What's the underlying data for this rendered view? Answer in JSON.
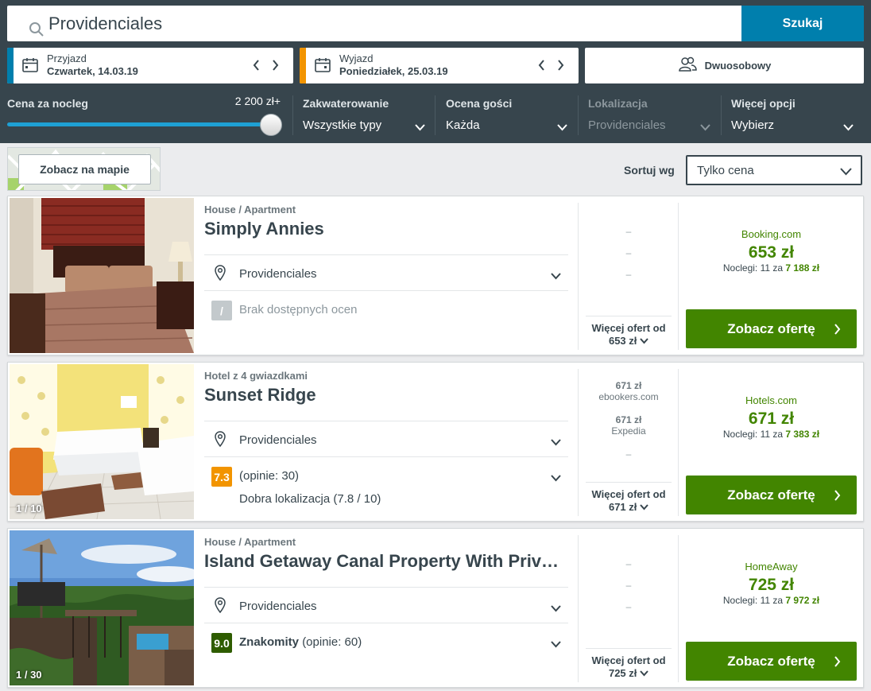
{
  "search": {
    "value": "Providenciales",
    "button": "Szukaj"
  },
  "checkin": {
    "label": "Przyjazd",
    "value": "Czwartek, 14.03.19",
    "accent": "#007fad"
  },
  "checkout": {
    "label": "Wyjazd",
    "value": "Poniedziałek, 25.03.19",
    "accent": "#f29400"
  },
  "room": {
    "label": "Dwuosobowy"
  },
  "filters": {
    "price": {
      "label": "Cena za nocleg",
      "max": "2 200 zł+",
      "level_percent": 100
    },
    "accommodation": {
      "label": "Zakwaterowanie",
      "value": "Wszystkie typy"
    },
    "rating": {
      "label": "Ocena gości",
      "value": "Każda"
    },
    "location": {
      "label": "Lokalizacja",
      "value": "Providenciales"
    },
    "more": {
      "label": "Więcej opcji",
      "value": "Wybierz"
    }
  },
  "toolbar": {
    "map_button": "Zobacz na mapie",
    "sort_label": "Sortuj wg",
    "sort_value": "Tylko cena"
  },
  "results": [
    {
      "category": "House / Apartment",
      "name": "Simply Annies",
      "location": "Providenciales",
      "rating_badge": "/",
      "rating_text": "Brak dostępnych ocen",
      "offers": [],
      "more_offers_label": "Więcej ofert od",
      "more_offers_price": "653 zł",
      "best_site": "Booking.com",
      "best_price": "653 zł",
      "nights_prefix": "Noclegi: 11 za",
      "nights_total": "7 188 zł",
      "cta": "Zobacz ofertę"
    },
    {
      "category": "Hotel z 4 gwiazdkami",
      "name": "Sunset Ridge",
      "photo_counter": "1 / 10",
      "location": "Providenciales",
      "rating_badge": "7.3",
      "rating_text": "(opinie: 30)",
      "rating_sub": "Dobra lokalizacja (7.8 / 10)",
      "offers": [
        {
          "price": "671 zł",
          "site": "ebookers.com"
        },
        {
          "price": "671 zł",
          "site": "Expedia"
        }
      ],
      "more_offers_label": "Więcej ofert od",
      "more_offers_price": "671 zł",
      "best_site": "Hotels.com",
      "best_price": "671 zł",
      "nights_prefix": "Noclegi: 11 za",
      "nights_total": "7 383 zł",
      "cta": "Zobacz ofertę"
    },
    {
      "category": "House / Apartment",
      "name": "Island Getaway Canal Property With Priv…",
      "photo_counter": "1 / 30",
      "location": "Providenciales",
      "rating_badge": "9.0",
      "rating_word": "Znakomity",
      "rating_text": "(opinie: 60)",
      "offers": [],
      "more_offers_label": "Więcej ofert od",
      "more_offers_price": "725 zł",
      "best_site": "HomeAway",
      "best_price": "725 zł",
      "nights_prefix": "Noclegi: 11 za",
      "nights_total": "7 972 zł",
      "cta": "Zobacz ofertę"
    }
  ],
  "placeholder_dash": "–",
  "colors": {
    "header_bg": "#37454d",
    "search_button": "#007fad",
    "cta_green": "#428500",
    "rating_orange": "#f29400",
    "rating_dark_green": "#2e5c00",
    "rating_none": "#c3c9cc"
  }
}
